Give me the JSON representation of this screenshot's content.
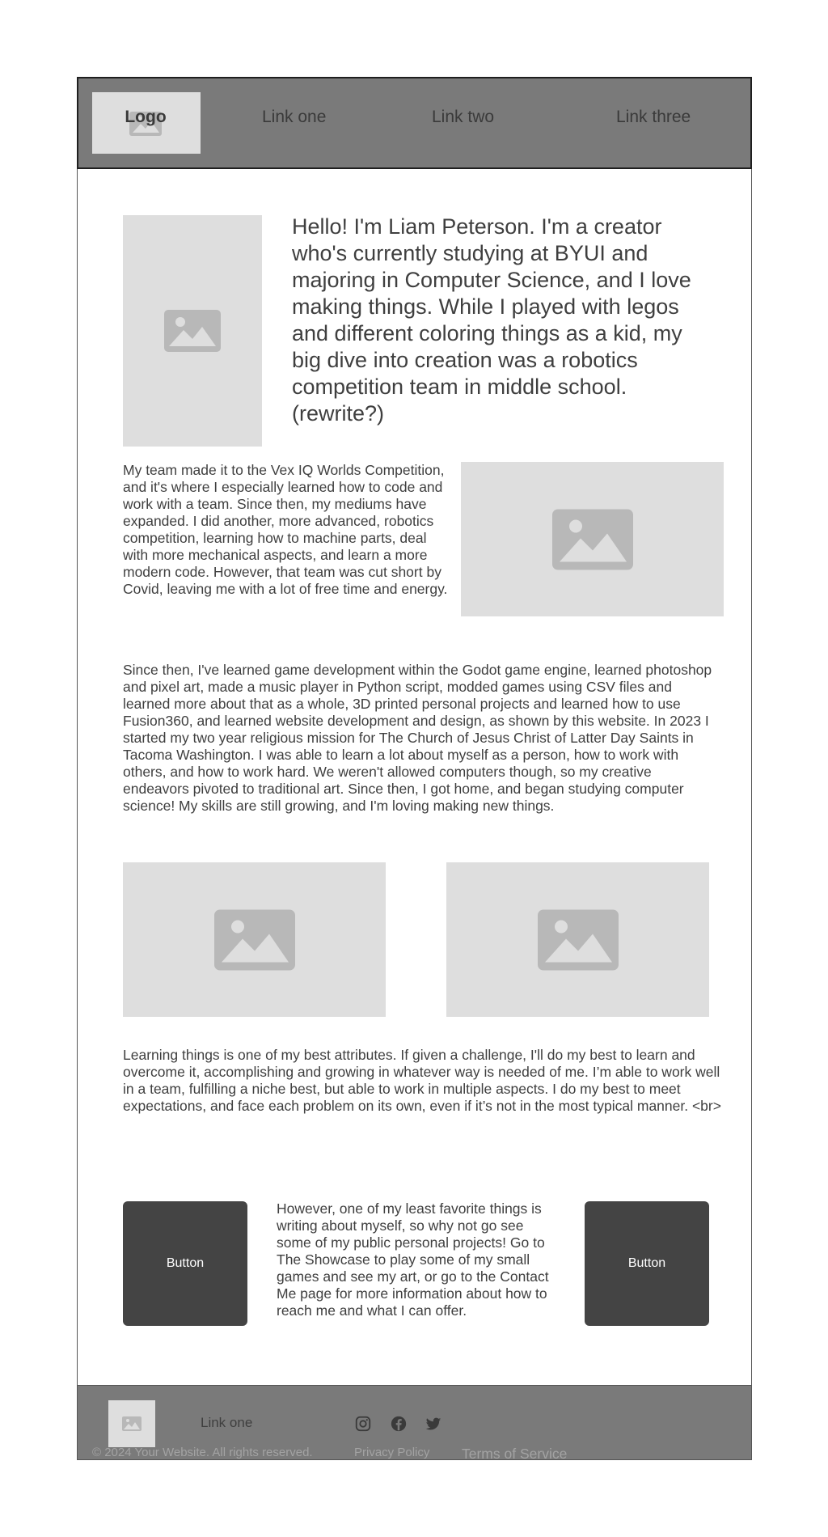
{
  "nav": {
    "logo_label": "Logo",
    "links": [
      "Link one",
      "Link two",
      "Link three"
    ]
  },
  "main": {
    "intro": "Hello! I'm Liam Peterson. I'm a creator who's currently studying at BYUI and majoring in Computer Science, and I love making things. While I played with legos and different coloring things as a kid, my big dive into creation was a robotics competition team in middle school. (rewrite?)",
    "paragraph_1": "My team made it to the Vex IQ Worlds Competition, and it's where I especially learned how to code and work with a team. Since then, my mediums have expanded. I did another, more advanced, robotics competition, learning how to machine parts, deal with more mechanical aspects, and learn a more modern code. However, that team was cut short by Covid, leaving me with a lot of free time and energy.",
    "paragraph_2": "Since then, I've learned game development within the Godot game engine, learned photoshop and pixel art, made a music player in Python script, modded games using CSV files and learned more about that as a whole, 3D printed personal projects and learned how to use Fusion360, and learned website development and design, as shown by this website. In 2023 I started my two year religious mission for The Church of Jesus Christ of Latter Day Saints in Tacoma Washington. I was able to learn a lot about myself as a person, how to work with others, and how to work hard. We weren't allowed computers though, so my creative endeavors pivoted to traditional art. Since then, I got home, and began studying computer science! My skills are still growing, and I'm loving making new things.",
    "paragraph_3": "Learning things is one of my best attributes. If given a challenge, I'll do my best to learn and overcome it, accomplishing and growing in whatever way is needed of me. I’m able to work well in a team, fulfilling a niche best, but able to work in multiple aspects. I do my best to meet expectations, and face each problem on its own, even if it’s not in the most typical manner. <br>",
    "paragraph_4": "However, one of my least favorite things is writing about myself, so why not go see some of my public personal projects! Go to The Showcase to play some of my small games and see my art, or go to the Contact Me page for more information about how to reach me and what I can offer.",
    "button_left": "Button",
    "button_right": "Button"
  },
  "footer": {
    "link": "Link one",
    "social_icons": [
      "instagram-icon",
      "facebook-icon",
      "twitter-icon"
    ],
    "copyright": "© 2024 Your Website. All rights reserved.",
    "privacy": "Privacy Policy",
    "terms": "Terms of Service"
  },
  "colors": {
    "nav_bg": "#7a7a7a",
    "placeholder_bg": "#dedede",
    "placeholder_icon": "#b8b8b8",
    "button_bg": "#444444",
    "text": "#3f3f3f"
  }
}
